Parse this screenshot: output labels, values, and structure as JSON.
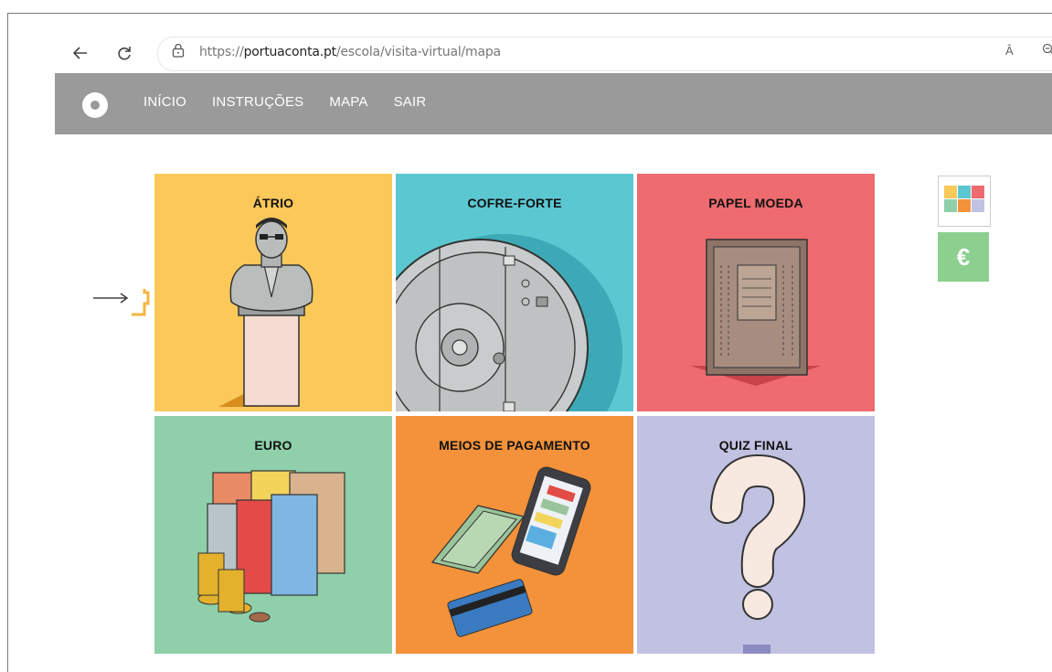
{
  "browser": {
    "url_scheme": "https://",
    "url_domain": "portuaconta.pt",
    "url_path": "/escola/visita-virtual/mapa",
    "read_aloud_label": "Ȃ"
  },
  "site": {
    "menu": [
      "INÍCIO",
      "INSTRUÇÕES",
      "MAPA",
      "SAIR"
    ]
  },
  "tiles": [
    {
      "title": "ÁTRIO",
      "color": "#fbc85a"
    },
    {
      "title": "COFRE-FORTE",
      "color": "#5bc7d1"
    },
    {
      "title": "PAPEL MOEDA",
      "color": "#ee6b6f"
    },
    {
      "title": "EURO",
      "color": "#8fd0ab"
    },
    {
      "title": "MEIOS DE PAGAMENTO",
      "color": "#f3923a"
    },
    {
      "title": "QUIZ FINAL",
      "color": "#c1c1e2"
    }
  ],
  "sidebar": {
    "euro_symbol": "€",
    "euro_color": "#8ccf8f"
  }
}
